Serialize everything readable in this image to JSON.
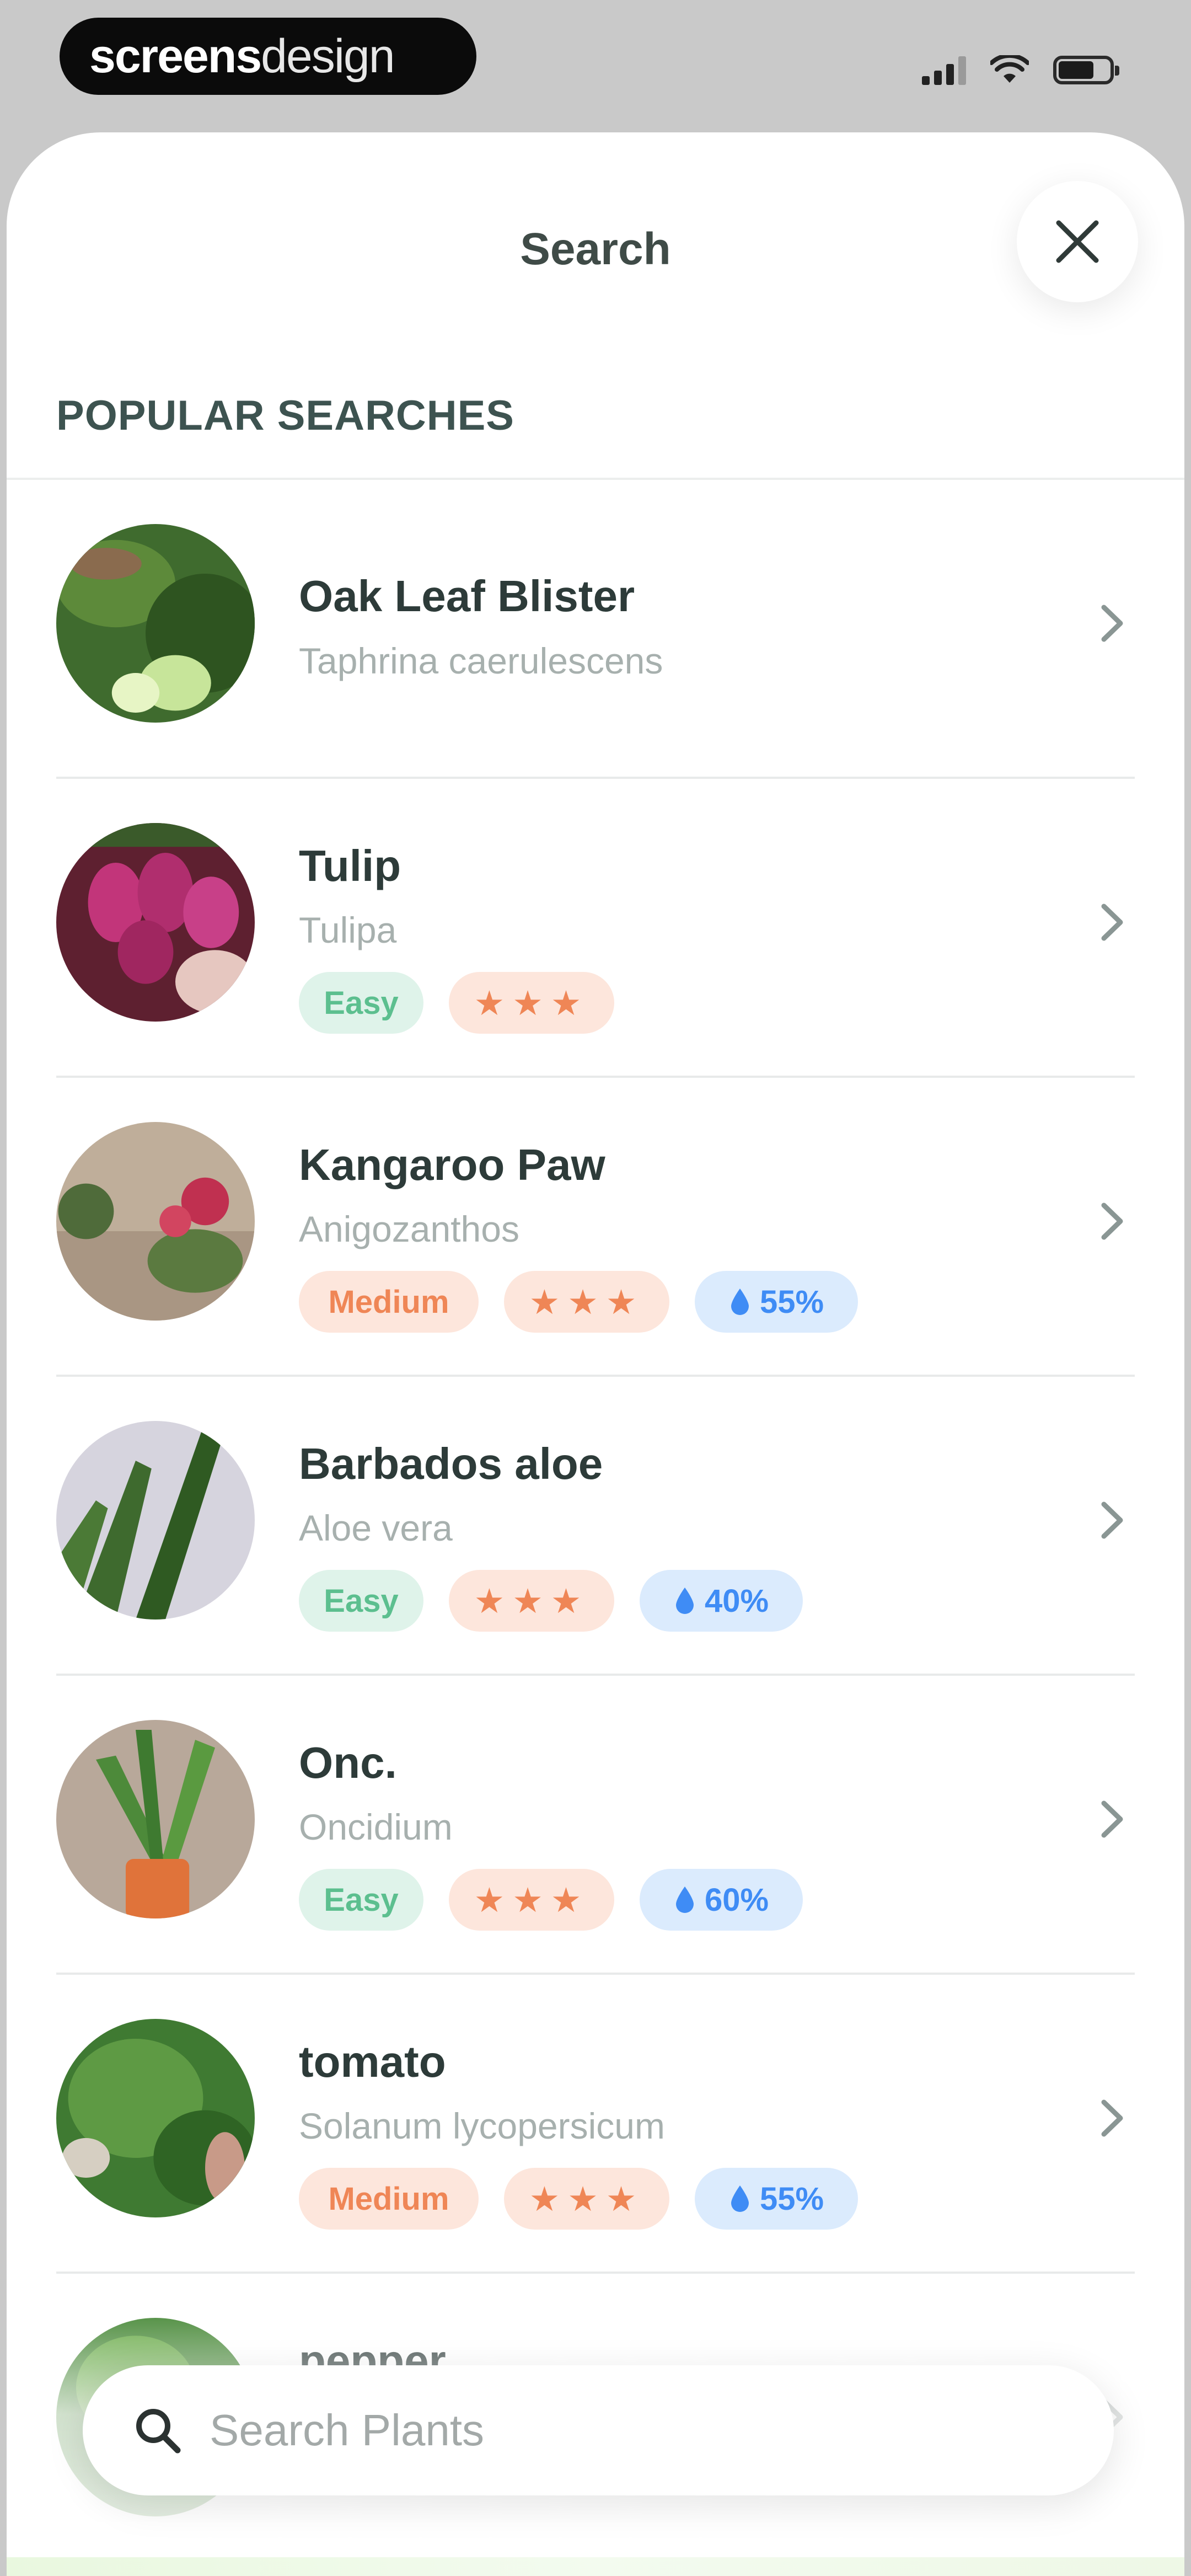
{
  "status_bar": {
    "brand_bold": "screens",
    "brand_light": "design"
  },
  "sheet": {
    "title": "Search",
    "section_header": "POPULAR SEARCHES"
  },
  "icons": {
    "close": "close-icon",
    "chevron": "chevron-right-icon",
    "search": "search-icon",
    "water": "water-drop-icon",
    "star": "star-icon"
  },
  "colors": {
    "easy_bg": "#dff3ea",
    "easy_text": "#5cbf8f",
    "medium_bg": "#fde6dc",
    "medium_text": "#ef8656",
    "water_bg": "#dbebfd",
    "water_text": "#3f8cf5"
  },
  "plants": [
    {
      "name": "Oak Leaf Blister",
      "scientific": "Taphrina caerulescens"
    },
    {
      "name": "Tulip",
      "scientific": "Tulipa",
      "difficulty": "Easy",
      "stars": "★★★"
    },
    {
      "name": "Kangaroo Paw",
      "scientific": "Anigozanthos",
      "difficulty": "Medium",
      "stars": "★★★",
      "water": "55%"
    },
    {
      "name": "Barbados aloe",
      "scientific": "Aloe vera",
      "difficulty": "Easy",
      "stars": "★★★",
      "water": "40%"
    },
    {
      "name": "Onc.",
      "scientific": "Oncidium",
      "difficulty": "Easy",
      "stars": "★★★",
      "water": "60%"
    },
    {
      "name": "tomato",
      "scientific": "Solanum lycopersicum",
      "difficulty": "Medium",
      "stars": "★★★",
      "water": "55%"
    },
    {
      "name": "pepper"
    }
  ],
  "search": {
    "placeholder": "Search Plants"
  }
}
